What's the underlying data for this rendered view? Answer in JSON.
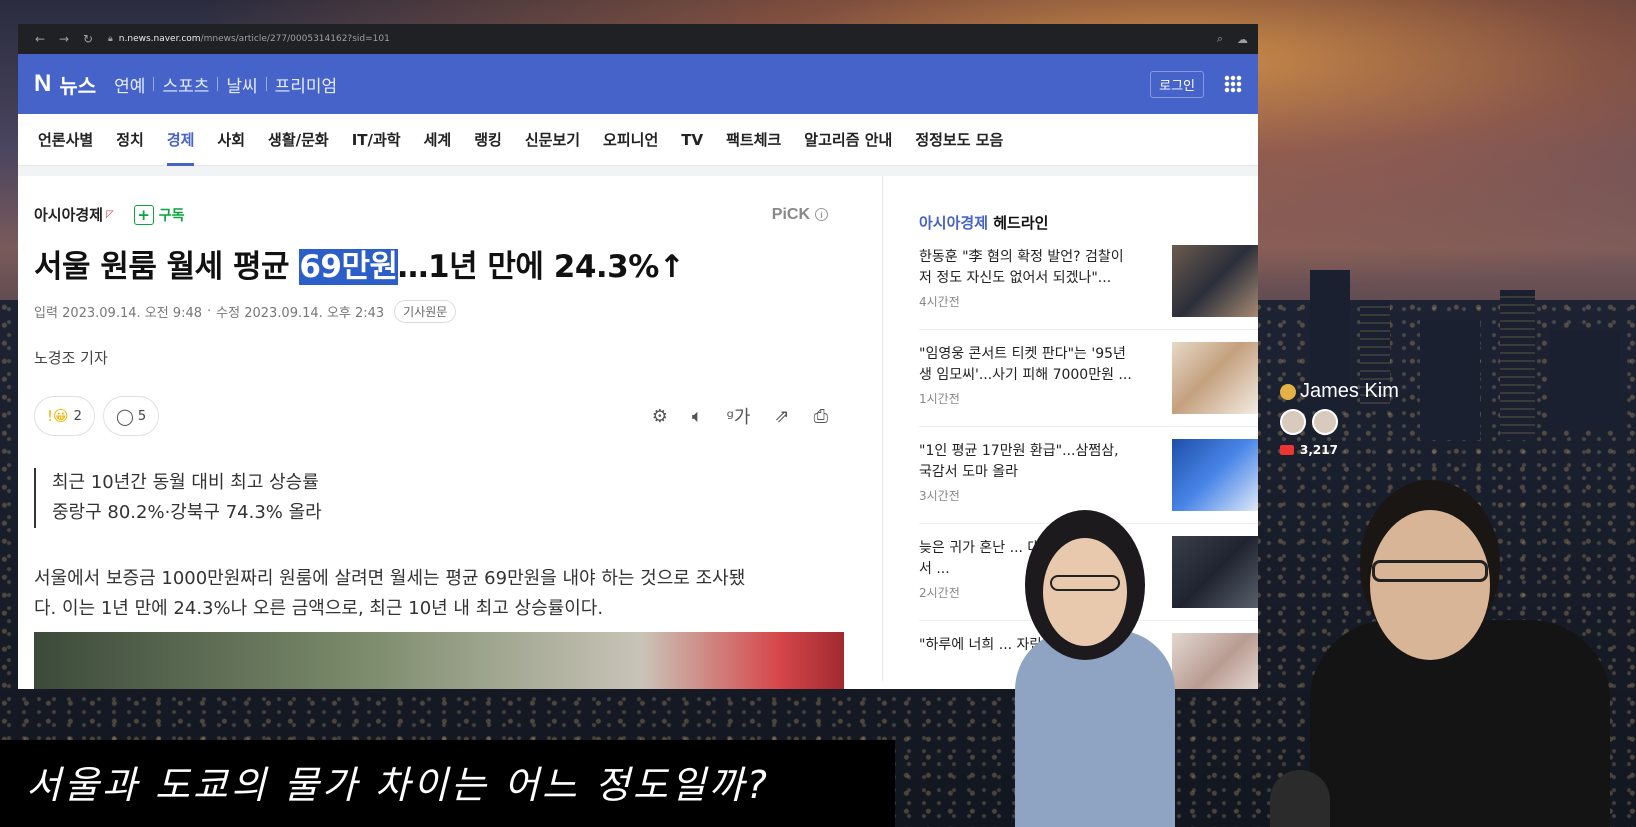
{
  "browser": {
    "url_host": "n.news.naver.com",
    "url_path": "/mnews/article/277/0005314162?sid=101"
  },
  "naver": {
    "logo": "N",
    "section": "뉴스",
    "top_menu": [
      "연예",
      "스포츠",
      "날씨",
      "프리미엄"
    ],
    "login": "로그인"
  },
  "categories": [
    "언론사별",
    "정치",
    "경제",
    "사회",
    "생활/문화",
    "IT/과학",
    "세계",
    "랭킹",
    "신문보기",
    "오피니언",
    "TV",
    "팩트체크",
    "알고리즘 안내",
    "정정보도 모음"
  ],
  "active_category": "경제",
  "article": {
    "press": "아시아경제",
    "subscribe": "구독",
    "pick": "PiCK",
    "headline_pre": "서울 원룸 월세 평균 ",
    "headline_hl": "69만원",
    "headline_post": "…1년 만에 24.3%↑",
    "input_label": "입력",
    "input_date": "2023.09.14. 오전 9:48",
    "edit_label": "수정",
    "edit_date": "2023.09.14. 오후 2:43",
    "original": "기사원문",
    "reporter": "노경조 기자",
    "reaction_count": "2",
    "comment_count": "5",
    "summary_1": "최근 10년간 동월 대비 최고 상승률",
    "summary_2": "중랑구 80.2%·강북구 74.3% 올라",
    "body_1": "서울에서 보증금 1000만원짜리 원룸에 살려면 월세는 평균 69만원을 내야 하는 것으로 조사됐",
    "body_2": "다. 이는 1년 만에 24.3%나 오른 금액으로, 최근 10년 내 최고 상승률이다."
  },
  "sidebar": {
    "press": "아시아경제",
    "title_suffix": " 헤드라인",
    "items": [
      {
        "text": "한동훈 \"李 혐의 확정 발언? 검찰이 저 정도 자신도 없어서 되겠나\"...",
        "time": "4시간전"
      },
      {
        "text": "\"임영웅 콘서트 티켓 판다\"는 '95년생 임모씨'...사기 피해 7000만원 ...",
        "time": "1시간전"
      },
      {
        "text": "\"1인 평균 17만원 환급\"...삼쩜삼, 국감서 도마 올라",
        "time": "3시간전"
      },
      {
        "text": "늦은 귀가 혼난 ... 대학생...첫 재판서 ...",
        "time": "2시간전"
      },
      {
        "text": "\"하루에 너희 ... 자란 데 ...",
        "time": ""
      }
    ]
  },
  "stream": {
    "name": "James Kim",
    "views": "3,217",
    "subtitle": "서울과 도쿄의 물가 차이는 어느 정도일까?"
  }
}
